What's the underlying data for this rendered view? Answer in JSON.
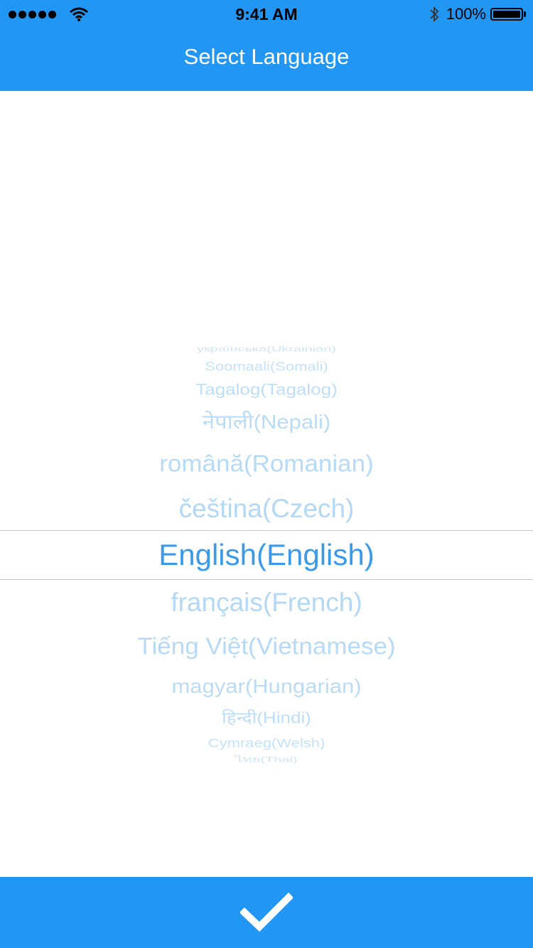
{
  "status_bar": {
    "time": "9:41 AM",
    "battery": "100%"
  },
  "header": {
    "title": "Select Language"
  },
  "picker": {
    "items": [
      "українська(Ukrainian)",
      "Soomaali(Somali)",
      "Tagalog(Tagalog)",
      "नेपाली(Nepali)",
      "română(Romanian)",
      "čeština(Czech)",
      "English(English)",
      "français(French)",
      "Tiếng Việt(Vietnamese)",
      "magyar(Hungarian)",
      "हिन्दी(Hindi)",
      "Cymraeg(Welsh)",
      "ไทย(Thai)"
    ],
    "selected": "English(English)"
  },
  "footer": {
    "confirm_icon": "checkmark-icon"
  },
  "colors": {
    "primary": "#2196f3",
    "picker_text": "#4aa3ea"
  }
}
